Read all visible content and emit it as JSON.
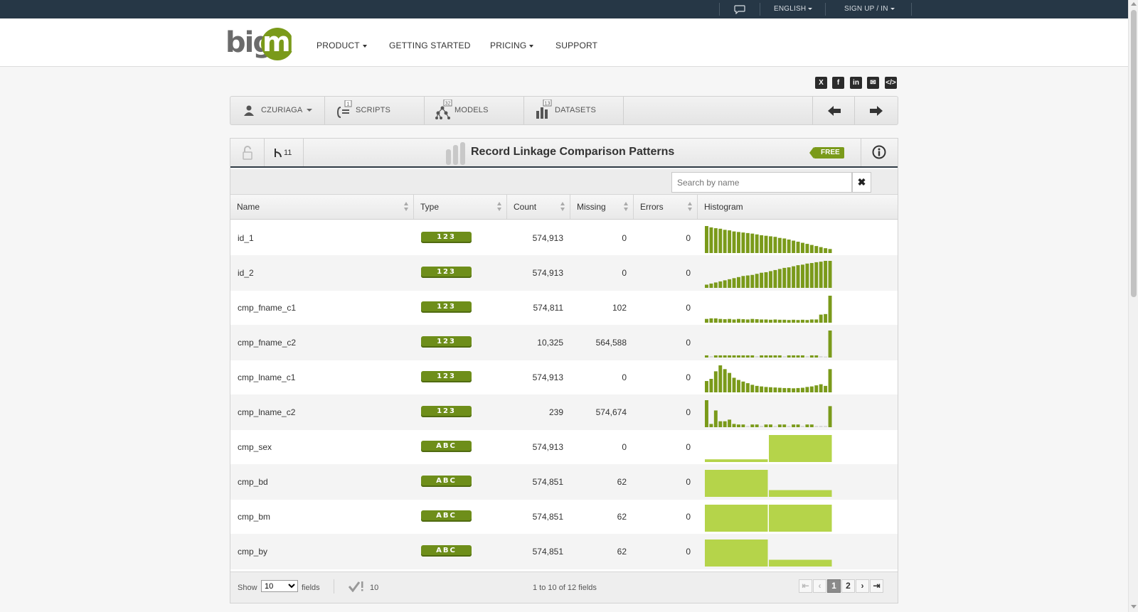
{
  "topbar": {
    "language": "ENGLISH",
    "signup": "SIGN UP / IN"
  },
  "header": {
    "logo_big": "big",
    "logo_ml": "ml",
    "nav": [
      {
        "label": "PRODUCT",
        "dropdown": true
      },
      {
        "label": "GETTING STARTED",
        "dropdown": false
      },
      {
        "label": "PRICING",
        "dropdown": true
      },
      {
        "label": "SUPPORT",
        "dropdown": false
      }
    ]
  },
  "share_icons": [
    "x-icon",
    "facebook-icon",
    "linkedin-icon",
    "email-icon",
    "embed-icon"
  ],
  "toolbar": {
    "user": "CZURIAGA",
    "scripts": "SCRIPTS",
    "scripts_badge": "1",
    "models": "MODELS",
    "models_badge": "32",
    "datasets": "DATASETS",
    "datasets_badge": "13"
  },
  "panel": {
    "title": "Record Linkage Comparison Patterns",
    "fork_count": "11",
    "free_label": "FREE",
    "search_placeholder": "Search by name",
    "columns": [
      "Name",
      "Type",
      "Count",
      "Missing",
      "Errors",
      "Histogram"
    ]
  },
  "fields": [
    {
      "name": "id_1",
      "type": "123",
      "count": "574,913",
      "missing": "0",
      "errors": "0",
      "hist": [
        1.0,
        0.95,
        0.92,
        0.9,
        0.86,
        0.84,
        0.8,
        0.78,
        0.76,
        0.74,
        0.72,
        0.69,
        0.66,
        0.64,
        0.62,
        0.6,
        0.56,
        0.54,
        0.5,
        0.46,
        0.42,
        0.38,
        0.34,
        0.3,
        0.26,
        0.22,
        0.18,
        0.15
      ]
    },
    {
      "name": "id_2",
      "type": "123",
      "count": "574,913",
      "missing": "0",
      "errors": "0",
      "hist": [
        0.12,
        0.16,
        0.2,
        0.24,
        0.28,
        0.32,
        0.36,
        0.4,
        0.44,
        0.46,
        0.48,
        0.52,
        0.56,
        0.58,
        0.62,
        0.66,
        0.7,
        0.74,
        0.76,
        0.8,
        0.84,
        0.86,
        0.9,
        0.92,
        0.95,
        0.97,
        1.0,
        1.0
      ]
    },
    {
      "name": "cmp_fname_c1",
      "type": "123",
      "count": "574,811",
      "missing": "102",
      "errors": "0",
      "hist": [
        0.14,
        0.16,
        0.16,
        0.14,
        0.13,
        0.14,
        0.12,
        0.14,
        0.13,
        0.12,
        0.14,
        0.13,
        0.12,
        0.12,
        0.11,
        0.12,
        0.11,
        0.11,
        0.1,
        0.11,
        0.1,
        0.11,
        0.1,
        0.12,
        0.12,
        0.3,
        0.32,
        1.0
      ]
    },
    {
      "name": "cmp_fname_c2",
      "type": "123",
      "count": "10,325",
      "missing": "564,588",
      "errors": "0",
      "hist": [
        0.08,
        0.05,
        0.08,
        0.08,
        0.08,
        0.08,
        0.08,
        0.08,
        0.08,
        0.08,
        0.08,
        0.05,
        0.08,
        0.08,
        0.08,
        0.08,
        0.08,
        0.05,
        0.08,
        0.08,
        0.08,
        0.08,
        0.05,
        0.08,
        0.08,
        0.05,
        0.04,
        1.0
      ]
    },
    {
      "name": "cmp_lname_c1",
      "type": "123",
      "count": "574,913",
      "missing": "0",
      "errors": "0",
      "hist": [
        0.42,
        0.5,
        0.78,
        1.0,
        0.86,
        0.72,
        0.54,
        0.46,
        0.4,
        0.34,
        0.28,
        0.24,
        0.22,
        0.2,
        0.19,
        0.18,
        0.17,
        0.16,
        0.16,
        0.15,
        0.16,
        0.17,
        0.2,
        0.22,
        0.26,
        0.3,
        0.24,
        0.86
      ]
    },
    {
      "name": "cmp_lname_c2",
      "type": "123",
      "count": "239",
      "missing": "574,674",
      "errors": "0",
      "hist": [
        1.0,
        0.12,
        0.62,
        0.22,
        0.22,
        0.28,
        0.12,
        0.1,
        0.1,
        0.05,
        0.1,
        0.1,
        0.05,
        0.1,
        0.1,
        0.05,
        0.1,
        0.1,
        0.05,
        0.1,
        0.1,
        0.05,
        0.1,
        0.1,
        0.05,
        0.05,
        0.05,
        0.78
      ]
    },
    {
      "name": "cmp_sex",
      "type": "ABC",
      "count": "574,913",
      "missing": "0",
      "errors": "0",
      "cats": [
        0.1,
        1.0
      ]
    },
    {
      "name": "cmp_bd",
      "type": "ABC",
      "count": "574,851",
      "missing": "62",
      "errors": "0",
      "cats": [
        1.0,
        0.25
      ]
    },
    {
      "name": "cmp_bm",
      "type": "ABC",
      "count": "574,851",
      "missing": "62",
      "errors": "0",
      "cats": [
        1.0,
        1.0
      ]
    },
    {
      "name": "cmp_by",
      "type": "ABC",
      "count": "574,851",
      "missing": "62",
      "errors": "0",
      "cats": [
        1.0,
        0.25
      ]
    }
  ],
  "footer": {
    "show_label": "Show",
    "show_value": "10",
    "fields_label": "fields",
    "valid_count": "10",
    "range_text": "1 to 10 of 12 fields",
    "pages": [
      "1",
      "2"
    ]
  },
  "colors": {
    "histogram_numeric": "#7a9a1a",
    "histogram_categorical": "#b5d44a",
    "type_badge": "#6e8e1a",
    "topbar": "#263746"
  }
}
